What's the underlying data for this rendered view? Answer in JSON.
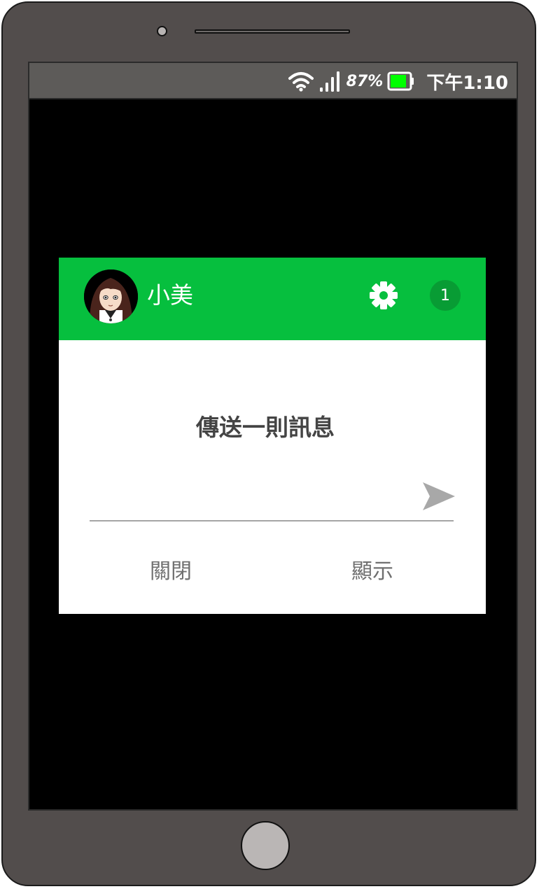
{
  "status_bar": {
    "battery_percent": "87%",
    "time": "下午1:10",
    "battery_color": "#00ff00"
  },
  "dialog": {
    "header": {
      "contact_name": "小美",
      "unread_count": "1",
      "accent_color": "#06bf3e"
    },
    "prompt": "傳送一則訊息",
    "message_input": {
      "value": "",
      "placeholder": ""
    },
    "buttons": {
      "close_label": "關閉",
      "show_label": "顯示"
    }
  },
  "icons": [
    "wifi-icon",
    "signal-icon",
    "battery-icon",
    "gear-icon",
    "send-icon"
  ]
}
